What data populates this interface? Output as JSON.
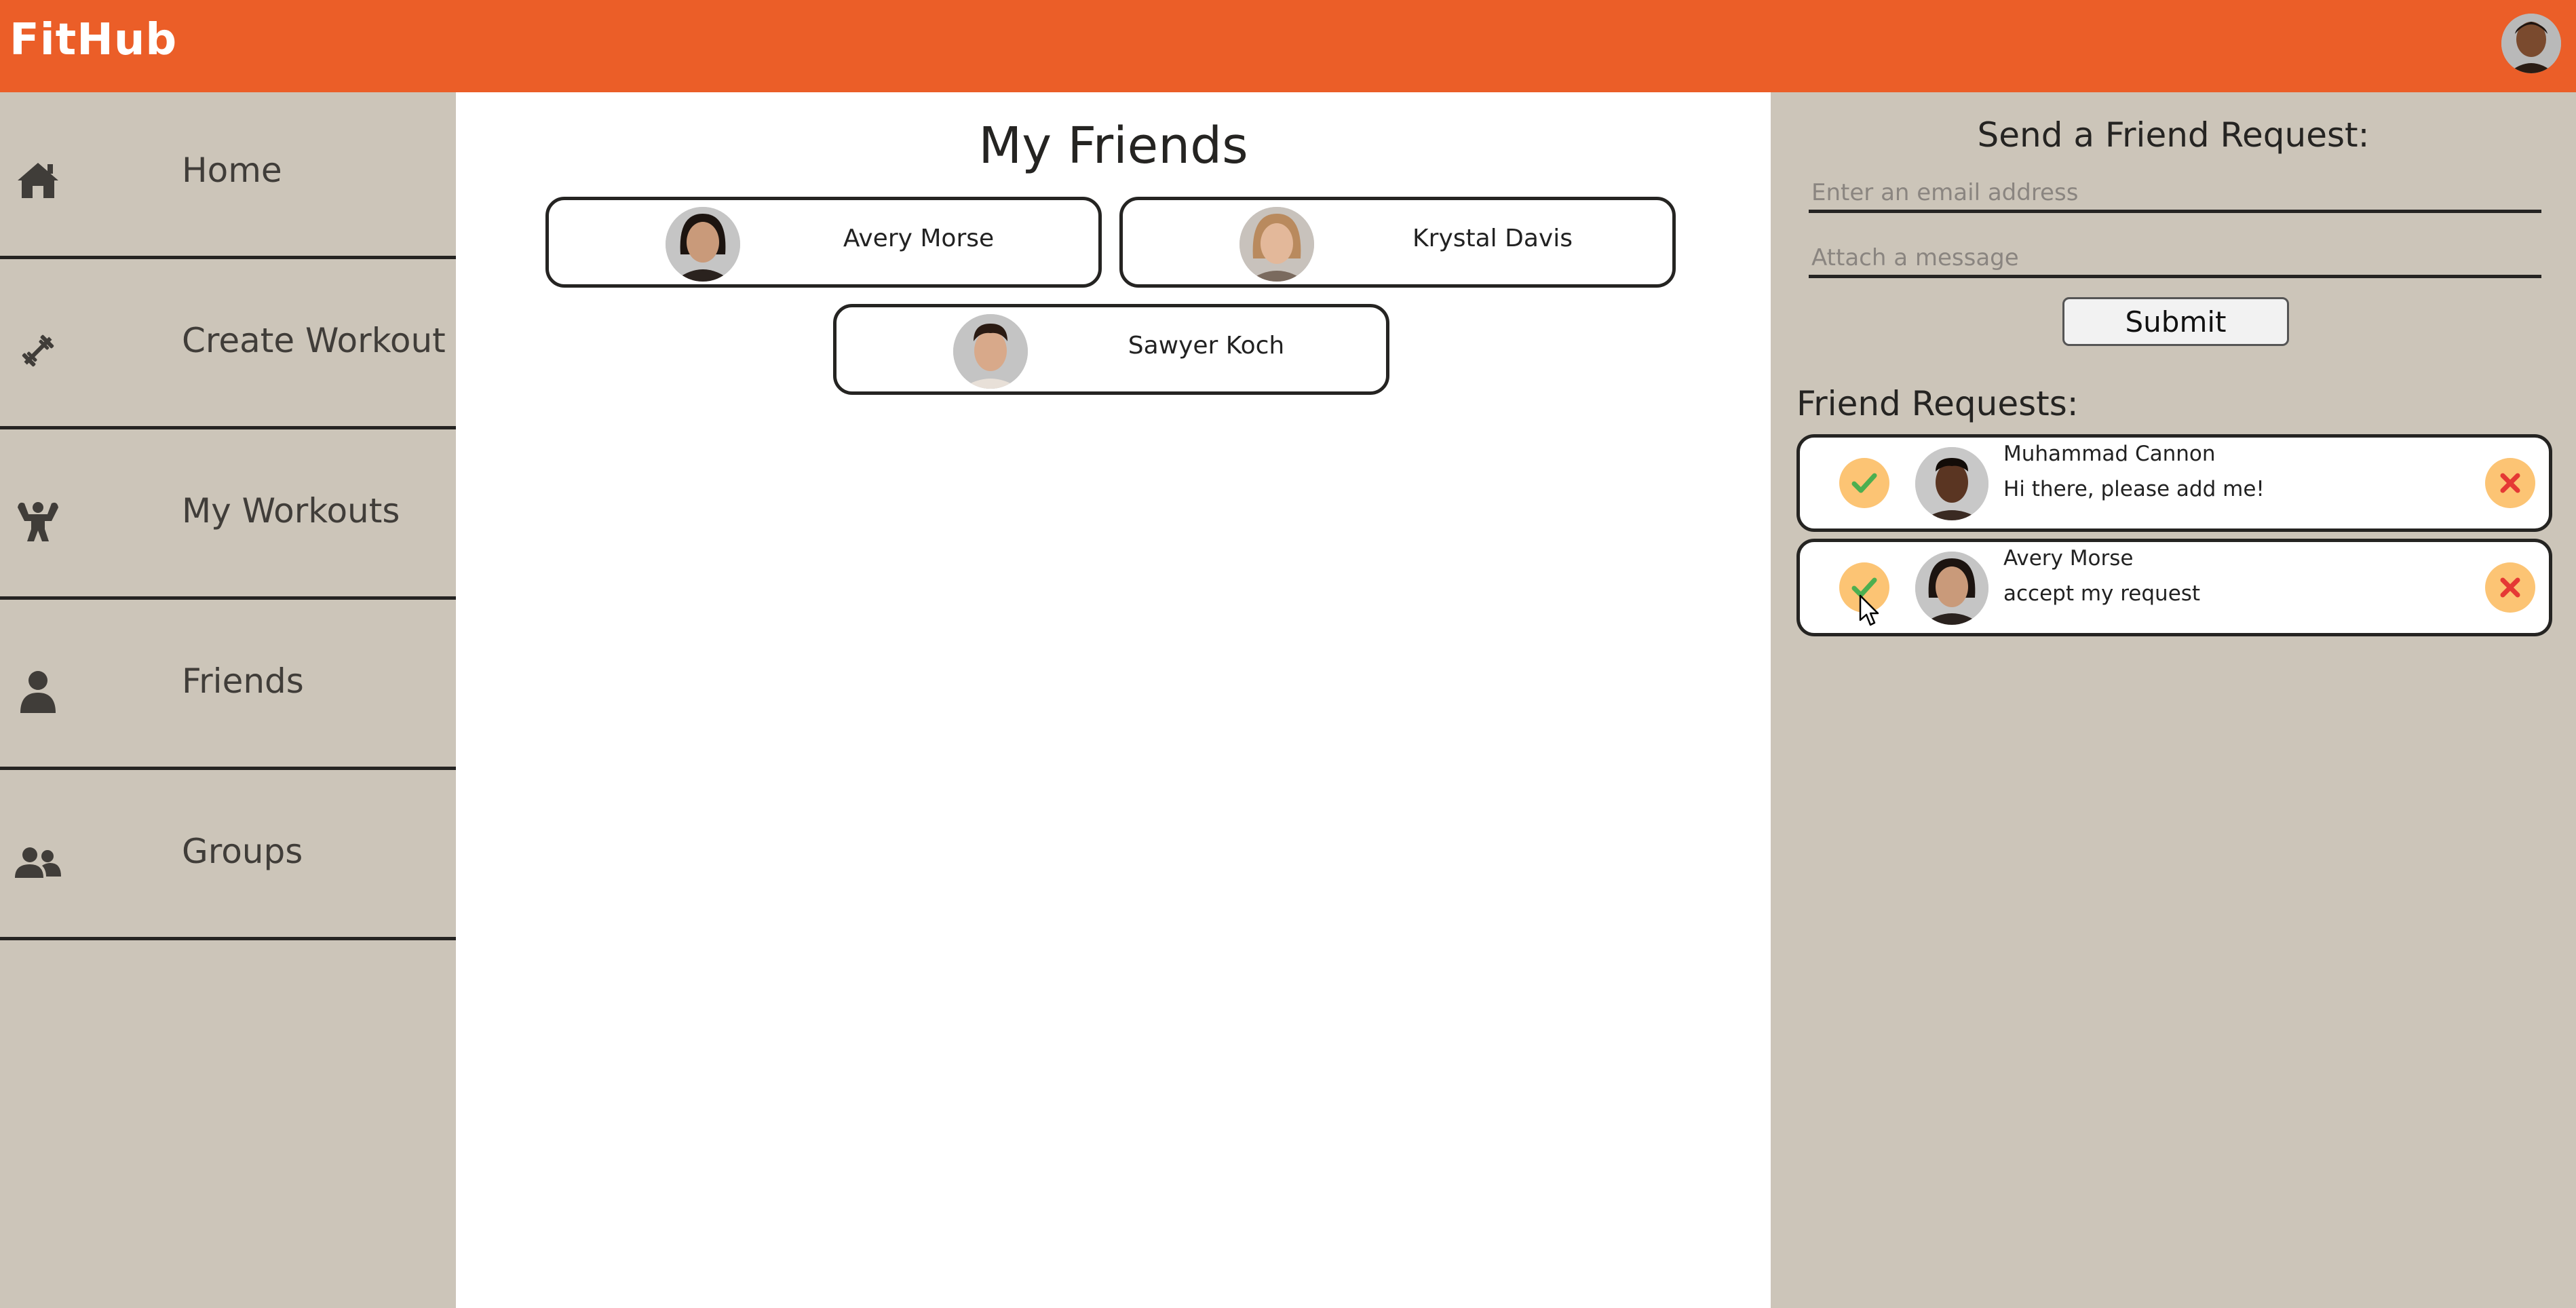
{
  "app": {
    "name": "FitHub"
  },
  "header": {
    "avatar_icon": "user-avatar-photo"
  },
  "sidebar": {
    "items": [
      {
        "label": "Home",
        "icon": "home-icon"
      },
      {
        "label": "Create Workout",
        "icon": "dumbbell-icon"
      },
      {
        "label": "My Workouts",
        "icon": "flexing-figure-icon"
      },
      {
        "label": "Friends",
        "icon": "user-icon"
      },
      {
        "label": "Groups",
        "icon": "users-icon"
      }
    ]
  },
  "main": {
    "title": "My Friends",
    "friends": [
      {
        "name": "Avery Morse"
      },
      {
        "name": "Krystal Davis"
      },
      {
        "name": "Sawyer Koch"
      }
    ]
  },
  "send_request": {
    "title": "Send a Friend Request:",
    "email_placeholder": "Enter an email address",
    "message_placeholder": "Attach a message",
    "submit_label": "Submit"
  },
  "friend_requests": {
    "title": "Friend Requests:",
    "items": [
      {
        "name": "Muhammad Cannon",
        "message": "Hi there, please add me!"
      },
      {
        "name": "Avery Morse",
        "message": "accept my request"
      }
    ]
  },
  "colors": {
    "header": "#eb5e28",
    "sidebar": "#ccc5b9",
    "border": "#252422",
    "action_circle": "#fcc474",
    "accept": "#4caf50",
    "reject": "#e53935"
  }
}
